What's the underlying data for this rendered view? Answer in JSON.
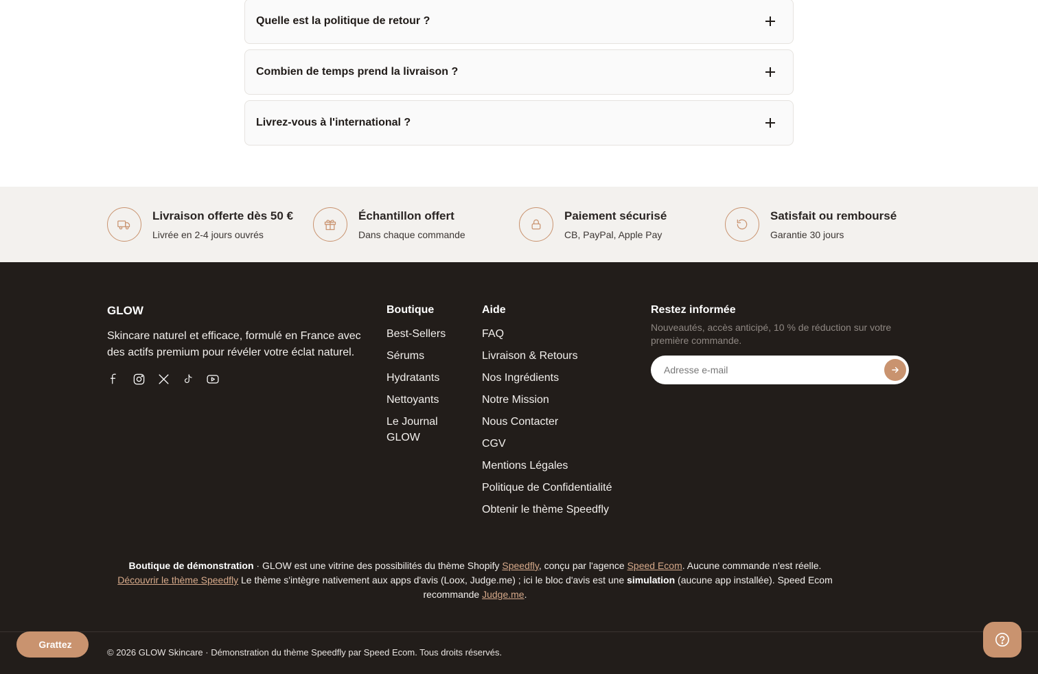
{
  "faq": {
    "items": [
      {
        "question": "Quelle est la politique de retour ?"
      },
      {
        "question": "Combien de temps prend la livraison ?"
      },
      {
        "question": "Livrez-vous à l'international ?"
      }
    ]
  },
  "trust": {
    "items": [
      {
        "icon": "truck-icon",
        "title": "Livraison offerte dès 50 €",
        "subtitle": "Livrée en 2-4 jours ouvrés"
      },
      {
        "icon": "gift-icon",
        "title": "Échantillon offert",
        "subtitle": "Dans chaque commande"
      },
      {
        "icon": "lock-icon",
        "title": "Paiement sécurisé",
        "subtitle": "CB, PayPal, Apple Pay"
      },
      {
        "icon": "refresh-icon",
        "title": "Satisfait ou remboursé",
        "subtitle": "Garantie 30 jours"
      }
    ]
  },
  "footer": {
    "brand": {
      "title": "GLOW",
      "description": "Skincare naturel et efficace, formulé en France avec des actifs premium pour révéler votre éclat naturel."
    },
    "socials": [
      "facebook-icon",
      "instagram-icon",
      "x-icon",
      "tiktok-icon",
      "youtube-icon"
    ],
    "boutique": {
      "title": "Boutique",
      "links": [
        "Best-Sellers",
        "Sérums",
        "Hydratants",
        "Nettoyants",
        "Le Journal GLOW"
      ]
    },
    "aide": {
      "title": "Aide",
      "links": [
        "FAQ",
        "Livraison & Retours",
        "Nos Ingrédients",
        "Notre Mission",
        "Nous Contacter",
        "CGV",
        "Mentions Légales",
        "Politique de Confidentialité",
        "Obtenir le thème Speedfly"
      ]
    },
    "newsletter": {
      "title": "Restez informée",
      "description": "Nouveautés, accès anticipé, 10 % de réduction sur votre première commande.",
      "placeholder": "Adresse e-mail"
    },
    "demo_note": {
      "bold1": "Boutique de démonstration",
      "text1": " · GLOW est une vitrine des possibilités du thème Shopify ",
      "link1": "Speedfly",
      "text2": ", conçu par l'agence ",
      "link2": "Speed Ecom",
      "text3": ". Aucune commande n'est réelle.",
      "link3": "Découvrir le thème Speedfly",
      "text4": " Le thème s'intègre nativement aux apps d'avis (Loox, Judge.me) ; ici le bloc d'avis est une ",
      "bold2": "simulation",
      "text5": " (aucune app installée). Speed Ecom recommande ",
      "link4": "Judge.me",
      "text6": "."
    },
    "copyright": "© 2026 GLOW Skincare · Démonstration du thème Speedfly par Speed Ecom. Tous droits réservés."
  },
  "widgets": {
    "grattez_label": "Grattez",
    "grattez_icon": "",
    "help_icon": "help-icon"
  },
  "colors": {
    "accent": "#c9936f",
    "footer_bg": "#221d1a",
    "trust_bg": "#f3f1ee"
  }
}
